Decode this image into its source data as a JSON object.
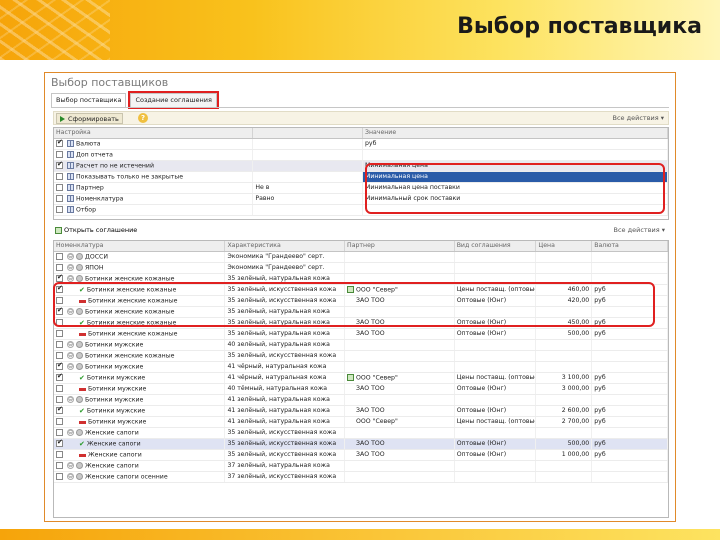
{
  "slide": {
    "title": "Выбор поставщика"
  },
  "window": {
    "title": "Выбор поставщиков",
    "tabs": [
      {
        "label": "Выбор поставщика"
      },
      {
        "label": "Создание соглашения"
      }
    ]
  },
  "toolbar": {
    "form_label": "Сформировать",
    "help": "?",
    "actions_label": "Все действия ▾"
  },
  "settings": {
    "headers": [
      "Настройка",
      "",
      "Значение"
    ],
    "rows": [
      {
        "checked": true,
        "label": "Валюта",
        "mid": "",
        "value": "руб"
      },
      {
        "checked": false,
        "label": "Доп отчета",
        "mid": "",
        "value": ""
      },
      {
        "checked": true,
        "label": "Расчет по не истечений",
        "mid": "",
        "value": "Минимальная цена"
      },
      {
        "checked": false,
        "label": "Показывать только не закрытые",
        "mid": "",
        "value": "Минимальная цена"
      },
      {
        "checked": false,
        "label": "Партнер",
        "mid": "Не в",
        "value": "Минимальная цена поставки"
      },
      {
        "checked": false,
        "label": "Номенклатура",
        "mid": "Равно",
        "value": "Минимальный срок поставки"
      },
      {
        "checked": false,
        "label": "Отбор",
        "mid": "",
        "value": ""
      }
    ]
  },
  "toolbar2": {
    "open_label": "Открыть соглашение",
    "actions_label": "Все действия ▾"
  },
  "results": {
    "headers": [
      "Номенклатура",
      "Характеристика",
      "Партнер",
      "Вид соглашения",
      "Цена",
      "Валюта"
    ],
    "rows": [
      {
        "cb": false,
        "kind": "group",
        "name": "ДОССИ",
        "char": "Экономика \"Грандеево\" серт.",
        "partner": "",
        "deal": "",
        "price": "",
        "cur": ""
      },
      {
        "cb": false,
        "kind": "group",
        "name": "ЯПОН",
        "char": "Экономика \"Грандеево\" серт.",
        "partner": "",
        "deal": "",
        "price": "",
        "cur": ""
      },
      {
        "cb": true,
        "kind": "group",
        "name": "Ботинки женские кожаные",
        "char": "35 зелёный, натуральная кожа",
        "partner": "",
        "deal": "",
        "price": "",
        "cur": ""
      },
      {
        "cb": true,
        "kind": "ok",
        "name": "Ботинки женские кожаные",
        "char": "35 зелёный, искусственная кожа",
        "partner": "ООО \"Север\"",
        "deal": "Цены поставщ. (оптовые)",
        "price": "460,00",
        "cur": "руб"
      },
      {
        "cb": false,
        "kind": "minus",
        "name": "Ботинки женские кожаные",
        "char": "35 зелёный, искусственная кожа",
        "partner": "ЗАО ТОО",
        "deal": "Оптовые (Юнг)",
        "price": "420,00",
        "cur": "руб"
      },
      {
        "cb": true,
        "kind": "group",
        "name": "Ботинки женские кожаные",
        "char": "35 зелёный, натуральная кожа",
        "partner": "",
        "deal": "",
        "price": "",
        "cur": ""
      },
      {
        "cb": false,
        "kind": "ok",
        "name": "Ботинки женские кожаные",
        "char": "35 зелёный, натуральная кожа",
        "partner": "ЗАО ТОО",
        "deal": "Оптовые (Юнг)",
        "price": "450,00",
        "cur": "руб"
      },
      {
        "cb": false,
        "kind": "minus",
        "name": "Ботинки женские кожаные",
        "char": "35 зелёный, натуральная кожа",
        "partner": "ЗАО ТОО",
        "deal": "Оптовые (Юнг)",
        "price": "500,00",
        "cur": "руб"
      },
      {
        "cb": false,
        "kind": "group",
        "name": "Ботинки мужские",
        "char": "40 зелёный, натуральная кожа",
        "partner": "",
        "deal": "",
        "price": "",
        "cur": ""
      },
      {
        "cb": false,
        "kind": "group",
        "name": "Ботинки женские кожаные",
        "char": "35 зелёный, искусственная кожа",
        "partner": "",
        "deal": "",
        "price": "",
        "cur": ""
      },
      {
        "cb": true,
        "kind": "group",
        "name": "Ботинки мужские",
        "char": "41 чёрный, натуральная кожа",
        "partner": "",
        "deal": "",
        "price": "",
        "cur": ""
      },
      {
        "cb": true,
        "kind": "ok",
        "name": "Ботинки мужские",
        "char": "41 чёрный, натуральная кожа",
        "partner": "ООО \"Север\"",
        "deal": "Цены поставщ. (оптовые)",
        "price": "3 100,00",
        "cur": "руб"
      },
      {
        "cb": false,
        "kind": "minus",
        "name": "Ботинки мужские",
        "char": "40 тёмный, натуральная кожа",
        "partner": "ЗАО ТОО",
        "deal": "Оптовые (Юнг)",
        "price": "3 000,00",
        "cur": "руб"
      },
      {
        "cb": false,
        "kind": "group",
        "name": "Ботинки мужские",
        "char": "41 зелёный, натуральная кожа",
        "partner": "",
        "deal": "",
        "price": "",
        "cur": ""
      },
      {
        "cb": true,
        "kind": "ok",
        "name": "Ботинки мужские",
        "char": "41 зелёный, натуральная кожа",
        "partner": "ЗАО ТОО",
        "deal": "Оптовые (Юнг)",
        "price": "2 600,00",
        "cur": "руб"
      },
      {
        "cb": false,
        "kind": "minus",
        "name": "Ботинки мужские",
        "char": "41 зелёный, натуральная кожа",
        "partner": "ООО \"Север\"",
        "deal": "Цены поставщ. (оптовые)",
        "price": "2 700,00",
        "cur": "руб"
      },
      {
        "cb": false,
        "kind": "group",
        "name": "Женские сапоги",
        "char": "35 зелёный, искусственная кожа",
        "partner": "",
        "deal": "",
        "price": "",
        "cur": ""
      },
      {
        "cb": true,
        "kind": "ok",
        "name": "Женские сапоги",
        "char": "35 зелёный, искусственная кожа",
        "partner": "ЗАО ТОО",
        "deal": "Оптовые (Юнг)",
        "price": "500,00",
        "cur": "руб"
      },
      {
        "cb": false,
        "kind": "minus",
        "name": "Женские сапоги",
        "char": "35 зелёный, искусственная кожа",
        "partner": "ЗАО ТОО",
        "deal": "Оптовые (Юнг)",
        "price": "1 000,00",
        "cur": "руб"
      },
      {
        "cb": false,
        "kind": "group",
        "name": "Женские сапоги",
        "char": "37 зелёный, натуральная кожа",
        "partner": "",
        "deal": "",
        "price": "",
        "cur": ""
      },
      {
        "cb": false,
        "kind": "group",
        "name": "Женские сапоги осенние",
        "char": "37 зелёный, искусственная кожа",
        "partner": "",
        "deal": "",
        "price": "",
        "cur": ""
      }
    ]
  }
}
